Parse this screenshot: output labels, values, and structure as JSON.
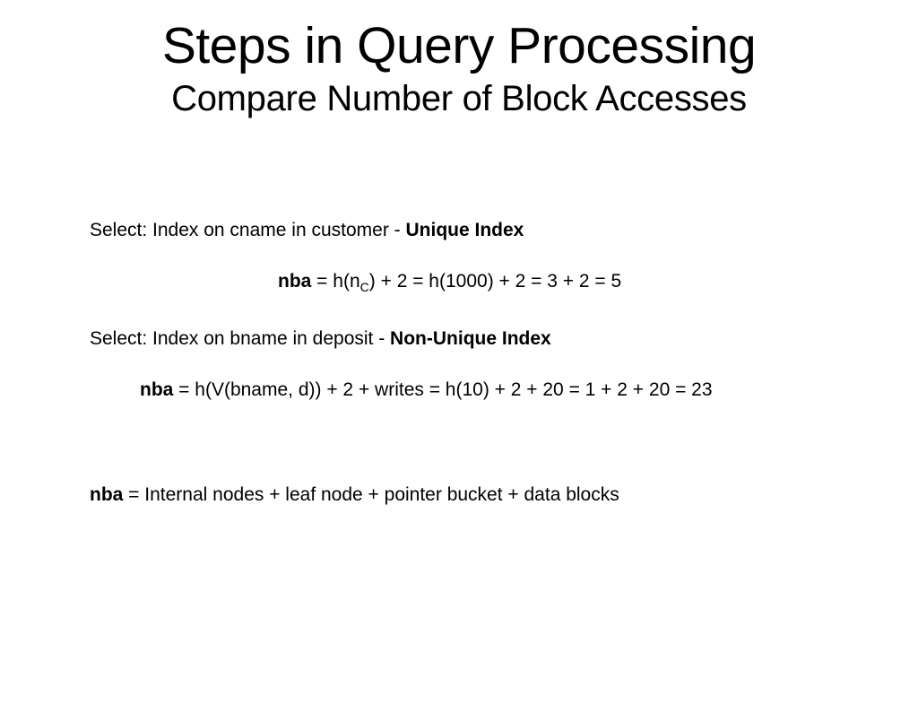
{
  "title": "Steps in Query Processing",
  "subtitle": "Compare Number of Block Accesses",
  "select1_prefix": "Select: Index on cname in customer - ",
  "select1_bold": "Unique Index",
  "formula1_bold": "nba",
  "formula1_a": " = h(n",
  "formula1_sub": "C",
  "formula1_b": ") + 2 = h(1000) + 2 = 3 + 2 = 5",
  "select2_prefix": "Select: Index on bname in deposit - ",
  "select2_bold": "Non-Unique Index",
  "formula2_bold": "nba",
  "formula2_rest": " = h(V(bname, d)) + 2 + writes = h(10) + 2 + 20 = 1 + 2 + 20 = 23",
  "footer_bold": "nba",
  "footer_rest": " = Internal nodes + leaf node + pointer bucket + data blocks"
}
